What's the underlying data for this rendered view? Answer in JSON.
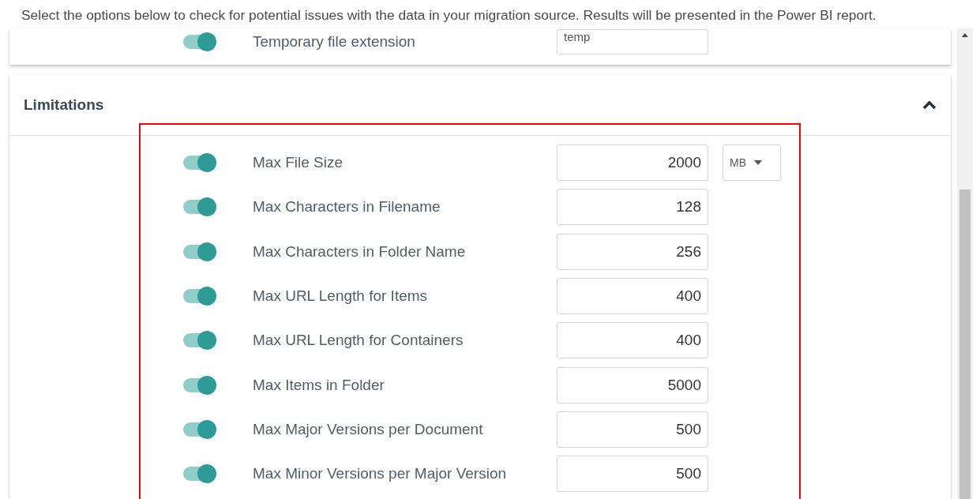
{
  "intro": "Select the options below to check for potential issues with the data in your migration source. Results will be presented in the Power BI report.",
  "previous_section": {
    "rows": [
      {
        "label": "Temporary file extension",
        "on": true,
        "value": "temp"
      }
    ]
  },
  "section": {
    "title": "Limitations",
    "expanded": true,
    "rows": [
      {
        "label": "Max File Size",
        "on": true,
        "value": "2000",
        "unit": "MB"
      },
      {
        "label": "Max Characters in Filename",
        "on": true,
        "value": "128"
      },
      {
        "label": "Max Characters in Folder Name",
        "on": true,
        "value": "256"
      },
      {
        "label": "Max URL Length for Items",
        "on": true,
        "value": "400"
      },
      {
        "label": "Max URL Length for Containers",
        "on": true,
        "value": "400"
      },
      {
        "label": "Max Items in Folder",
        "on": true,
        "value": "5000"
      },
      {
        "label": "Max Major Versions per Document",
        "on": true,
        "value": "500"
      },
      {
        "label": "Max Minor Versions per Major Version",
        "on": true,
        "value": "500"
      }
    ]
  }
}
